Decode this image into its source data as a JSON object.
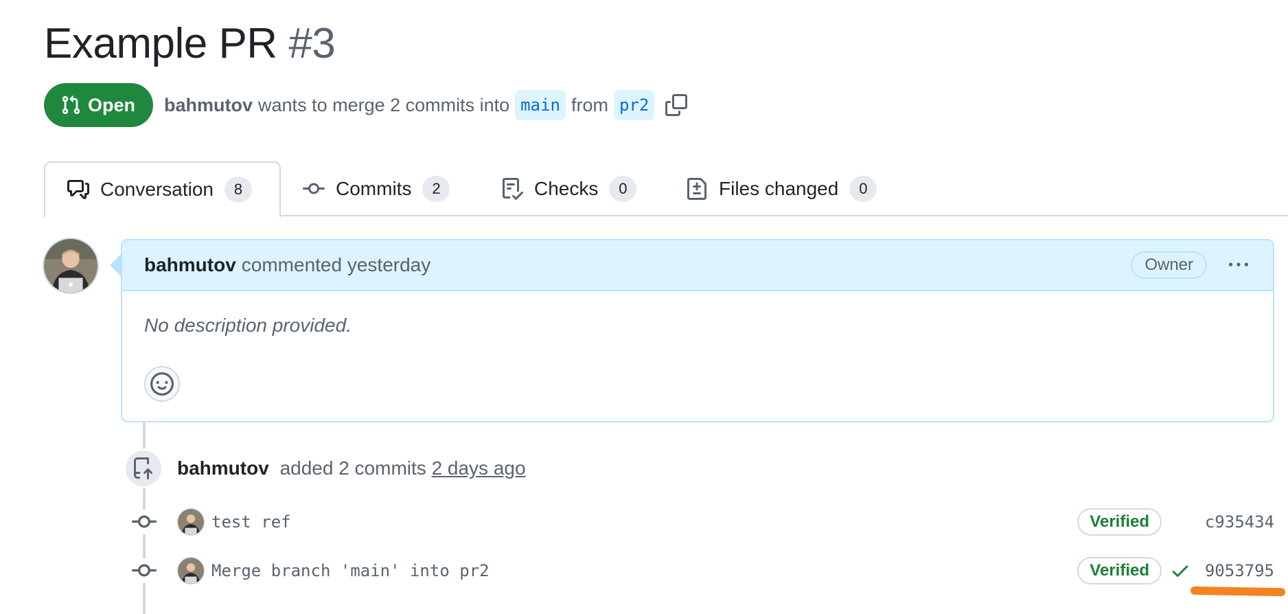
{
  "pr": {
    "title": "Example PR",
    "number": "#3",
    "state": "Open",
    "author": "bahmutov",
    "summary_text": "wants to merge 2 commits into",
    "base_branch": "main",
    "from_text": "from",
    "head_branch": "pr2"
  },
  "tabs": [
    {
      "label": "Conversation",
      "count": "8",
      "icon": "comment-discussion-icon"
    },
    {
      "label": "Commits",
      "count": "2",
      "icon": "git-commit-icon"
    },
    {
      "label": "Checks",
      "count": "0",
      "icon": "checklist-icon"
    },
    {
      "label": "Files changed",
      "count": "0",
      "icon": "file-diff-icon"
    }
  ],
  "comment": {
    "author": "bahmutov",
    "action": "commented yesterday",
    "role_badge": "Owner",
    "body": "No description provided."
  },
  "event": {
    "author": "bahmutov",
    "action": "added 2 commits",
    "time": "2 days ago"
  },
  "commits": [
    {
      "message": "test ref",
      "verified_label": "Verified",
      "sha": "c935434",
      "status_icon": ""
    },
    {
      "message": "Merge branch 'main' into pr2",
      "verified_label": "Verified",
      "sha": "9053795",
      "status_icon": "check-icon"
    }
  ],
  "colors": {
    "open_green": "#1f883d",
    "branch_blue": "#0969da",
    "comment_header_bg": "#ddf4ff",
    "verified_green": "#1a7f37",
    "highlight_orange": "#f58220"
  }
}
